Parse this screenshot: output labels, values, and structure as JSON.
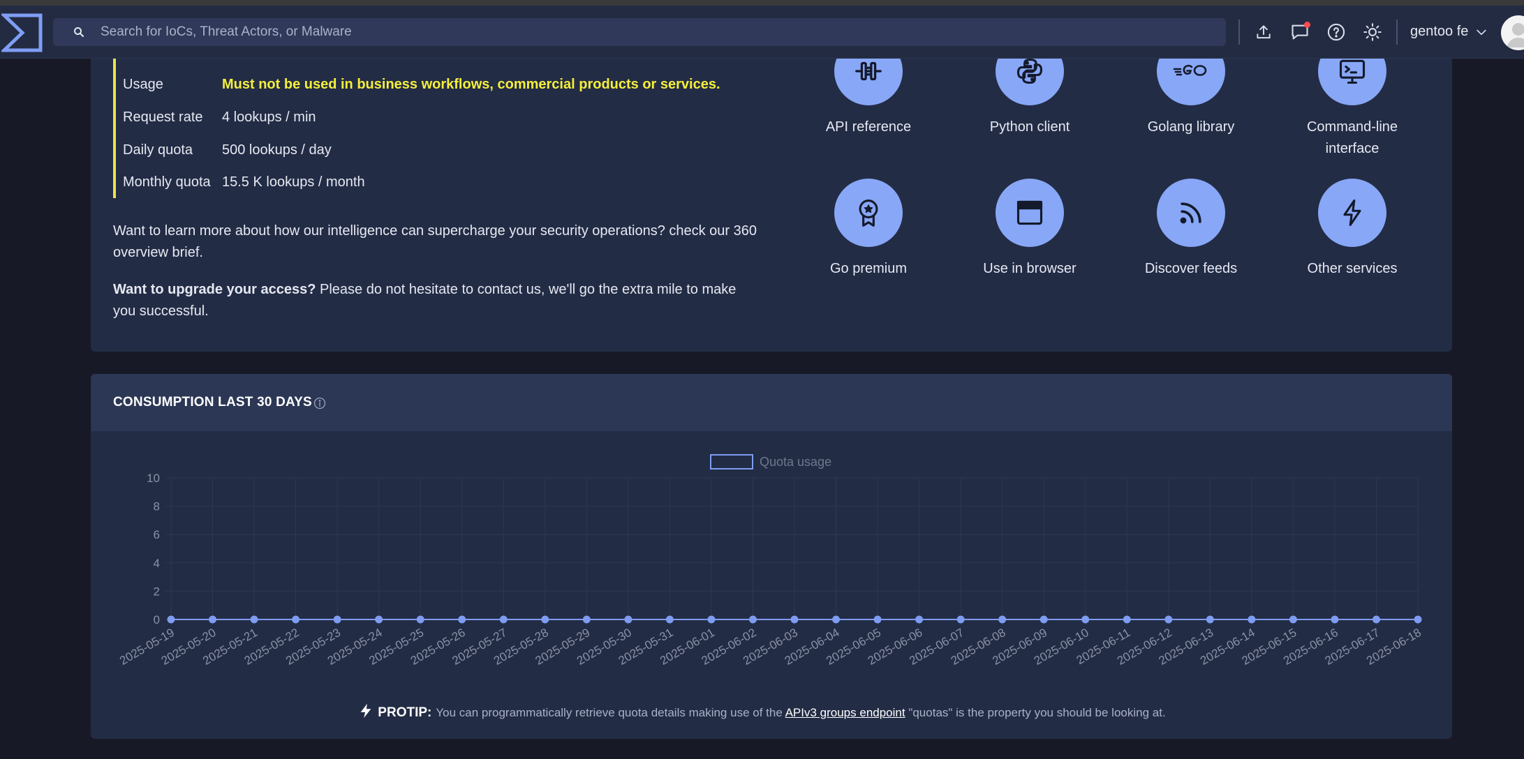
{
  "header": {
    "search_placeholder": "Search for IoCs, Threat Actors, or Malware",
    "user_name": "gentoo fe",
    "icons": [
      "logo-icon",
      "search-icon",
      "upload-icon",
      "comments-icon",
      "help-icon",
      "theme-sun-icon",
      "chevron-down-icon",
      "avatar"
    ]
  },
  "plan": {
    "rows": [
      {
        "label": "Usage",
        "value": "Must not be used in business workflows, commercial products or services."
      },
      {
        "label": "Request rate",
        "value": "4 lookups / min"
      },
      {
        "label": "Daily quota",
        "value": "500 lookups / day"
      },
      {
        "label": "Monthly quota",
        "value": "15.5 K lookups / month"
      }
    ],
    "learn_more": "Want to learn more about how our intelligence can supercharge your security operations? check our 360 overview brief.",
    "upgrade_bold": "Want to upgrade your access?",
    "upgrade_text": " Please do not hesitate to contact us, we'll go the extra mile to make you successful."
  },
  "tools": [
    {
      "label": "API reference",
      "icon": "api-icon"
    },
    {
      "label": "Python client",
      "icon": "python-icon"
    },
    {
      "label": "Golang library",
      "icon": "golang-icon"
    },
    {
      "label": "Command-line interface",
      "icon": "terminal-icon"
    },
    {
      "label": "Go premium",
      "icon": "premium-badge-icon"
    },
    {
      "label": "Use in browser",
      "icon": "browser-window-icon"
    },
    {
      "label": "Discover feeds",
      "icon": "rss-feed-icon"
    },
    {
      "label": "Other services",
      "icon": "bolt-icon"
    }
  ],
  "consumption": {
    "title": "CONSUMPTION LAST 30 DAYS"
  },
  "chart_data": {
    "type": "line",
    "title": "",
    "legend": "top-center",
    "series": [
      {
        "name": "Quota usage",
        "color": "#7e9cf2",
        "values": [
          0,
          0,
          0,
          0,
          0,
          0,
          0,
          0,
          0,
          0,
          0,
          0,
          0,
          0,
          0,
          0,
          0,
          0,
          0,
          0,
          0,
          0,
          0,
          0,
          0,
          0,
          0,
          0,
          0,
          0,
          0
        ]
      }
    ],
    "x": [
      "2025-05-19",
      "2025-05-20",
      "2025-05-21",
      "2025-05-22",
      "2025-05-23",
      "2025-05-24",
      "2025-05-25",
      "2025-05-26",
      "2025-05-27",
      "2025-05-28",
      "2025-05-29",
      "2025-05-30",
      "2025-05-31",
      "2025-06-01",
      "2025-06-02",
      "2025-06-03",
      "2025-06-04",
      "2025-06-05",
      "2025-06-06",
      "2025-06-07",
      "2025-06-08",
      "2025-06-09",
      "2025-06-10",
      "2025-06-11",
      "2025-06-12",
      "2025-06-13",
      "2025-06-14",
      "2025-06-15",
      "2025-06-16",
      "2025-06-17",
      "2025-06-18"
    ],
    "ylim": [
      0,
      10
    ],
    "yticks": [
      0,
      2,
      4,
      6,
      8,
      10
    ],
    "grid": true
  },
  "protip": {
    "label": "PROTIP:",
    "text_before": "You can programmatically retrieve quota details making use of the ",
    "link": "APIv3 groups endpoint",
    "text_after": " \"quotas\" is the property you should be looking at."
  }
}
